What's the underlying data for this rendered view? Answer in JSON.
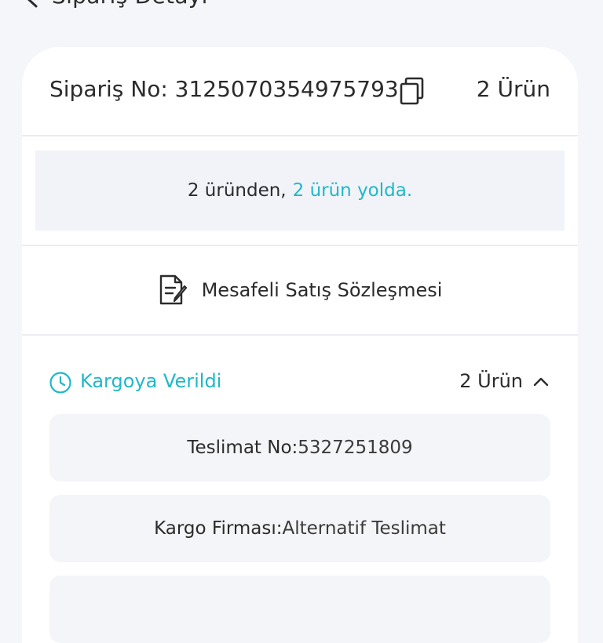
{
  "header": {
    "title": "Sipariş Detayı"
  },
  "order": {
    "label": "Sipariş No: 3125070354975793",
    "item_count": "2 Ürün"
  },
  "status": {
    "prefix": "2 üründen,",
    "highlight": "2 ürün yolda."
  },
  "contract": {
    "label": "Mesafeli Satış Sözleşmesi"
  },
  "shipment": {
    "status_label": "Kargoya Verildi",
    "item_count": "2 Ürün",
    "delivery_label": "Teslimat No:",
    "delivery_value": "5327251809",
    "carrier_label": "Kargo Firması:",
    "carrier_value": "Alternatif Teslimat"
  },
  "colors": {
    "accent": "#1fb8c8",
    "background": "#f4f6fa",
    "card": "#ffffff",
    "text": "#2b2b2b"
  }
}
